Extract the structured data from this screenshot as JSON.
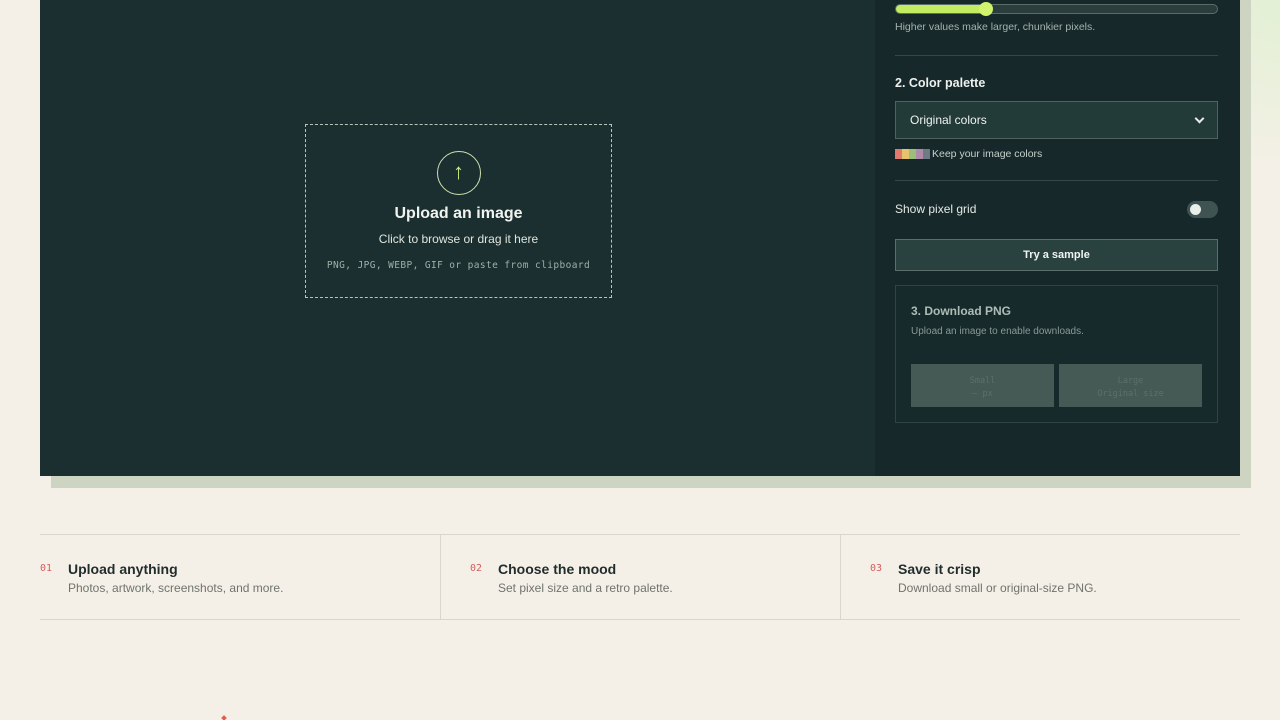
{
  "settings": {
    "pixel_size_level": 0.28,
    "pixel_size_hint": "Higher values make larger, chunkier pixels.",
    "palette_section_title": "2. Color palette",
    "palette_selected": "Original colors",
    "palette_note": "Keep your image colors",
    "palette_swatches": [
      "#e07a6e",
      "#e8c36e",
      "#9bbf7a",
      "#b08aa9",
      "#6f7b84"
    ],
    "show_grid_label": "Show pixel grid",
    "show_grid_enabled": false,
    "sample_button_label": "Try a sample"
  },
  "upload": {
    "icon": "upload-arrow-icon",
    "title": "Upload an image",
    "subtitle": "Click to browse or drag it here",
    "formats": "PNG, JPG, WEBP, GIF or paste from clipboard"
  },
  "download": {
    "title": "3. Download PNG",
    "note": "Upload an image to enable downloads.",
    "small_label": "Small",
    "small_size": "— px",
    "large_label": "Large",
    "large_size": "Original size"
  },
  "features": [
    {
      "num": "01",
      "title": "Upload anything",
      "desc": "Photos, artwork, screenshots, and more."
    },
    {
      "num": "02",
      "title": "Choose the mood",
      "desc": "Set pixel size and a retro palette."
    },
    {
      "num": "03",
      "title": "Save it crisp",
      "desc": "Download small or original-size PNG."
    }
  ],
  "colors": {
    "accent": "#c4ec63",
    "app_bg": "#1b2f31",
    "panel_bg": "#16282a",
    "page_bg": "#f5f0e7",
    "feature_num": "#d35e5b"
  }
}
